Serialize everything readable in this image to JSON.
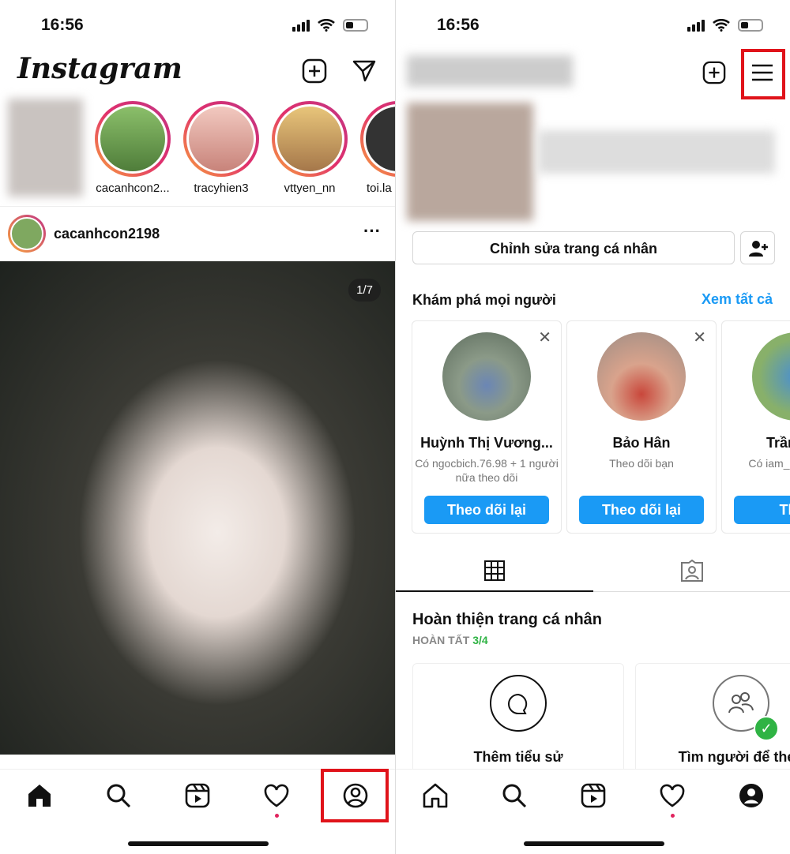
{
  "left": {
    "time": "16:56",
    "logo": "Instagram",
    "stories": [
      {
        "username": ""
      },
      {
        "username": "cacanhcon2..."
      },
      {
        "username": "tracyhien3"
      },
      {
        "username": "vttyen_nn"
      },
      {
        "username": "toi.la"
      }
    ],
    "post": {
      "username": "cacanhcon2198",
      "counter": "1/7"
    },
    "nav": [
      "home-icon",
      "search-icon",
      "reels-icon",
      "heart-icon",
      "profile-icon"
    ]
  },
  "right": {
    "time": "16:56",
    "edit_profile": "Chỉnh sửa trang cá nhân",
    "discover_title": "Khám phá mọi người",
    "see_all": "Xem tất cả",
    "suggestions": [
      {
        "name": "Huỳnh Thị Vương...",
        "sub": "Có ngocbich.76.98 + 1 người nữa theo dõi",
        "button": "Theo dõi lại"
      },
      {
        "name": "Bảo Hân",
        "sub": "Theo dõi bạn",
        "button": "Theo dõi lại"
      },
      {
        "name": "Trần Pha",
        "sub": "Có iam_c người nữ",
        "button": "Theo"
      }
    ],
    "complete_title": "Hoàn thiện trang cá nhân",
    "complete_label": "HOÀN TẤT",
    "complete_progress": "3/4",
    "tasks": [
      {
        "title": "Thêm tiểu sử",
        "done": false
      },
      {
        "title": "Tìm người để theo",
        "done": true
      }
    ]
  },
  "colors": {
    "accent": "#1a9af5",
    "highlight": "#e0131a",
    "done": "#2fb344"
  }
}
